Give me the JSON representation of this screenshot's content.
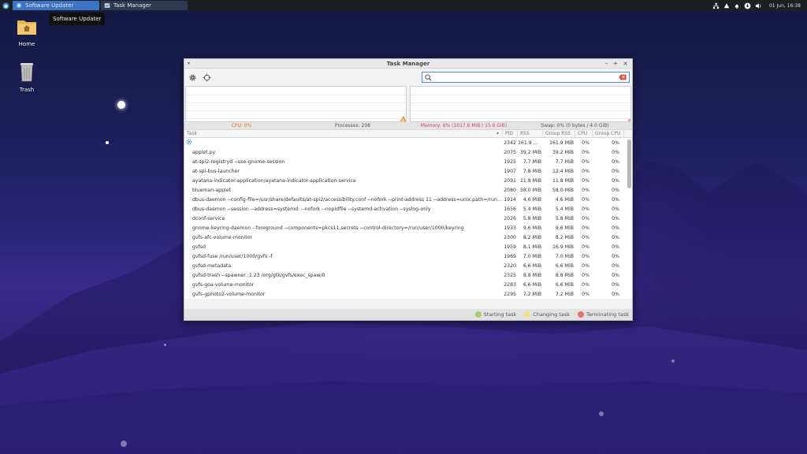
{
  "panel": {
    "tasks": [
      {
        "label": "Software Updater",
        "active": true
      },
      {
        "label": "Task Manager",
        "active": false
      }
    ],
    "clock": "01 Jun, 16:38",
    "tray_icons": [
      "network-icon",
      "notification-icon",
      "bell-icon",
      "updates-icon",
      "volume-icon"
    ]
  },
  "tooltip": "Software Updater",
  "desktop": {
    "icons": [
      {
        "name": "home",
        "label": "Home",
        "icon": "folder-home-icon"
      },
      {
        "name": "trash",
        "label": "Trash",
        "icon": "trash-icon"
      }
    ]
  },
  "window": {
    "title": "Task Manager",
    "search": {
      "value": "",
      "placeholder": ""
    },
    "status": {
      "cpu": "CPU: 0%",
      "processes": "Processes: 208",
      "memory": "Memory: 6% (1017.6 MiB / 15.6 GiB)",
      "swap": "Swap: 0% (0 bytes / 4.0 GiB)"
    },
    "columns": [
      "Task",
      "PID",
      "RSS",
      "Group RSS",
      "CPU",
      "Group CPU"
    ],
    "rows": [
      {
        "task": "",
        "pid": "2342",
        "rss": "161.9 MiB",
        "grss": "161.9 MiB",
        "cpu": "0%",
        "gcpu": "0%"
      },
      {
        "task": "applet.py",
        "pid": "2075",
        "rss": "39.2 MiB",
        "grss": "39.2 MiB",
        "cpu": "0%",
        "gcpu": "0%"
      },
      {
        "task": "at-spi2-registryd --use-gnome-session",
        "pid": "1925",
        "rss": "7.7 MiB",
        "grss": "7.7 MiB",
        "cpu": "0%",
        "gcpu": "0%"
      },
      {
        "task": "at-spi-bus-launcher",
        "pid": "1907",
        "rss": "7.8 MiB",
        "grss": "12.4 MiB",
        "cpu": "0%",
        "gcpu": "0%"
      },
      {
        "task": "ayatana-indicator-application/ayatana-indicator-application-service",
        "pid": "2091",
        "rss": "11.8 MiB",
        "grss": "11.8 MiB",
        "cpu": "0%",
        "gcpu": "0%"
      },
      {
        "task": "blueman-applet",
        "pid": "2080",
        "rss": "58.0 MiB",
        "grss": "58.0 MiB",
        "cpu": "0%",
        "gcpu": "0%"
      },
      {
        "task": "dbus-daemon --config-file=/usr/share/defaults/at-spi2/accessibility.conf --nofork --print-address 11 --address=unix:path=/run/user/...",
        "pid": "1914",
        "rss": "4.6 MiB",
        "grss": "4.6 MiB",
        "cpu": "0%",
        "gcpu": "0%"
      },
      {
        "task": "dbus-daemon --session --address=systemd: --nofork --nopidfile --systemd-activation --syslog-only",
        "pid": "1656",
        "rss": "5.4 MiB",
        "grss": "5.4 MiB",
        "cpu": "0%",
        "gcpu": "0%"
      },
      {
        "task": "dconf-service",
        "pid": "2026",
        "rss": "5.8 MiB",
        "grss": "5.8 MiB",
        "cpu": "0%",
        "gcpu": "0%"
      },
      {
        "task": "gnome-keyring-daemon --foreground --components=pkcs11,secrets --control-directory=/run/user/1000/keyring",
        "pid": "1933",
        "rss": "9.6 MiB",
        "grss": "9.6 MiB",
        "cpu": "0%",
        "gcpu": "0%"
      },
      {
        "task": "gvfs-afc-volume-monitor",
        "pid": "2300",
        "rss": "8.2 MiB",
        "grss": "8.2 MiB",
        "cpu": "0%",
        "gcpu": "0%"
      },
      {
        "task": "gvfsd",
        "pid": "1959",
        "rss": "8.1 MiB",
        "grss": "16.9 MiB",
        "cpu": "0%",
        "gcpu": "0%"
      },
      {
        "task": "gvfsd-fuse /run/user/1000/gvfs -f",
        "pid": "1969",
        "rss": "7.0 MiB",
        "grss": "7.0 MiB",
        "cpu": "0%",
        "gcpu": "0%"
      },
      {
        "task": "gvfsd-metadata",
        "pid": "2320",
        "rss": "6.6 MiB",
        "grss": "6.6 MiB",
        "cpu": "0%",
        "gcpu": "0%"
      },
      {
        "task": "gvfsd-trash --spawner :1.23 /org/gtk/gvfs/exec_spaw/0",
        "pid": "2325",
        "rss": "8.8 MiB",
        "grss": "8.8 MiB",
        "cpu": "0%",
        "gcpu": "0%"
      },
      {
        "task": "gvfs-goa-volume-monitor",
        "pid": "2283",
        "rss": "6.6 MiB",
        "grss": "6.6 MiB",
        "cpu": "0%",
        "gcpu": "0%"
      },
      {
        "task": "gvfs-gphoto2-volume-monitor",
        "pid": "2295",
        "rss": "7.2 MiB",
        "grss": "7.2 MiB",
        "cpu": "0%",
        "gcpu": "0%"
      }
    ],
    "legend": [
      {
        "label": "Starting task",
        "color": "#a6d16e"
      },
      {
        "label": "Changing task",
        "color": "#f5e27a"
      },
      {
        "label": "Terminating task",
        "color": "#e8736e"
      }
    ]
  },
  "colors": {
    "accent": "#3b73c6",
    "cpu_text": "#e07a1f",
    "memory_text": "#d0456a"
  }
}
